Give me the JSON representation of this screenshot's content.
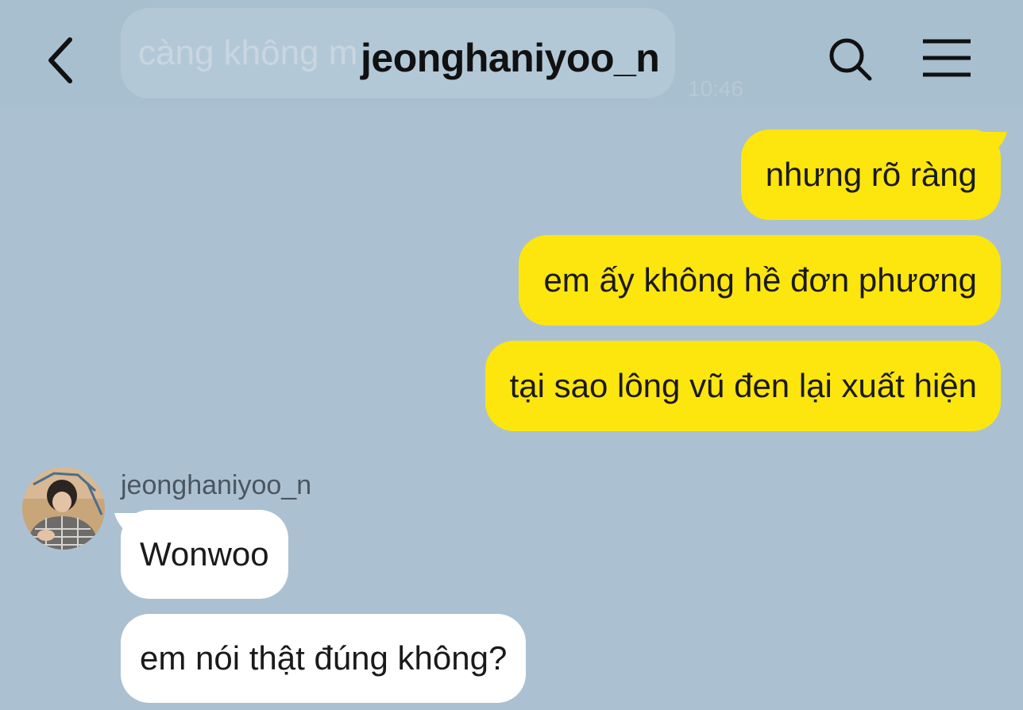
{
  "header": {
    "title": "jeonghaniyoo_n",
    "ghost_preview": "càng không m",
    "ghost_time": "10:46"
  },
  "messages_out": [
    {
      "text": "nhưng rõ ràng"
    },
    {
      "text": "em ấy không hề đơn phương"
    },
    {
      "text": "tại sao lông vũ đen lại xuất hiện"
    }
  ],
  "incoming": {
    "sender": "jeonghaniyoo_n",
    "messages": [
      {
        "text": "Wonwoo"
      },
      {
        "text": "em nói thật đúng không?"
      }
    ]
  },
  "icons": {
    "back": "chevron-left-icon",
    "search": "search-icon",
    "menu": "hamburger-menu-icon"
  },
  "colors": {
    "background": "#abc1d1",
    "outgoing_bubble": "#fde50e",
    "incoming_bubble": "#ffffff"
  }
}
